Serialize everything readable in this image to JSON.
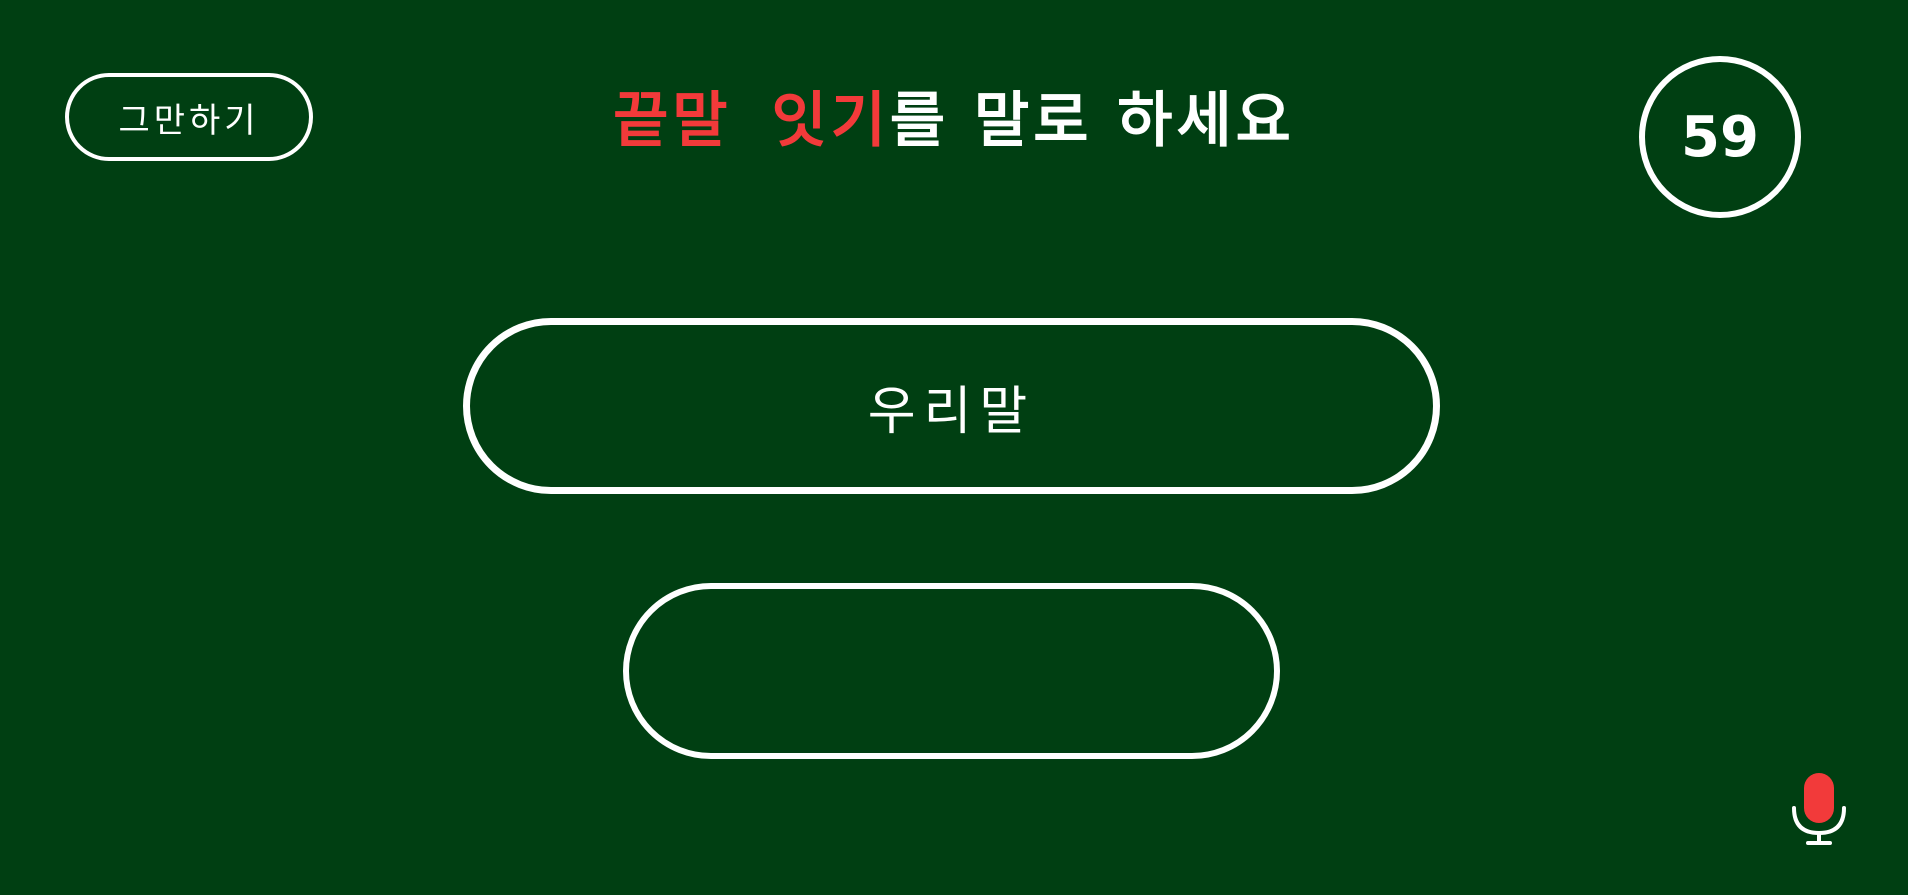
{
  "stop_button": {
    "label": "그만하기"
  },
  "title": {
    "part1": "끝말",
    "part2": "잇기",
    "rest": "를 말로 하세요",
    "highlight_color": "#f23a3a"
  },
  "timer": {
    "value": "59"
  },
  "word": {
    "text": "우리말"
  },
  "answer": {
    "text": ""
  },
  "mic": {
    "icon": "microphone-icon",
    "color": "#f23a3a"
  },
  "colors": {
    "background": "#003f12",
    "foreground": "#ffffff"
  }
}
